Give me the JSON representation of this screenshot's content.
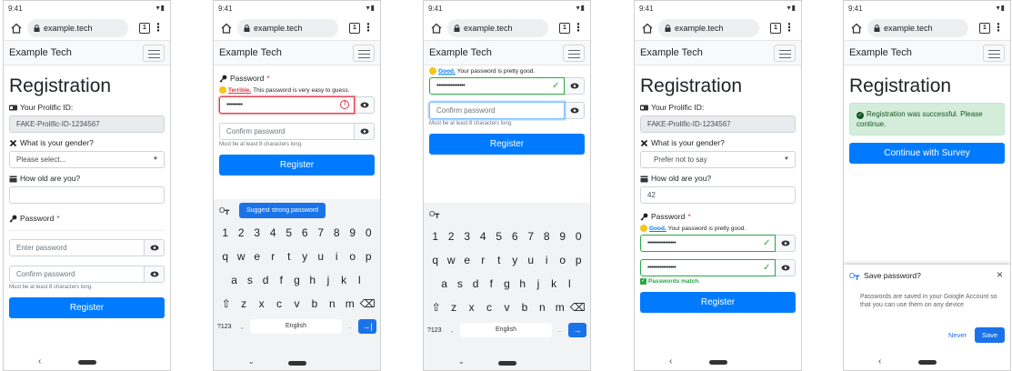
{
  "common": {
    "time": "9:41",
    "url": "example.tech",
    "tab_count": "1",
    "brand": "Example Tech",
    "kebab": "⋮"
  },
  "colors": {
    "primary": "#007bff",
    "success": "#28a745",
    "danger": "#dc3545",
    "chrome_blue": "#1a73e8"
  },
  "form": {
    "title": "Registration",
    "prolific_label": "Your Prolific ID:",
    "prolific_value": "FAKE-Prolific-ID-1234567",
    "gender_label": "What is your gender?",
    "gender_placeholder": "Please select...",
    "gender_selected": "Prefer not to say",
    "age_label": "How old are you?",
    "age_value": "42",
    "password_label": "Password",
    "password_required": "*",
    "password_placeholder": "Enter password",
    "confirm_placeholder": "Confirm password",
    "length_help": "Must be at least 8 characters long.",
    "register_label": "Register",
    "pw_short": "•••••••••",
    "pw_long": "••••••••••••••••",
    "strength_terrible_word": "Terrible.",
    "strength_terrible_text": " This password is very easy to guess.",
    "strength_good_word": "Good.",
    "strength_good_text": " Your password is pretty good.",
    "match_text": "Passwords match.",
    "success_text": "Registration was successful. Please continue.",
    "continue_label": "Continue with Survey"
  },
  "keyboard": {
    "suggest_label": "Suggest strong password",
    "row_numbers": [
      "1",
      "2",
      "3",
      "4",
      "5",
      "6",
      "7",
      "8",
      "9",
      "0"
    ],
    "row_top": [
      "q",
      "w",
      "e",
      "r",
      "t",
      "y",
      "u",
      "i",
      "o",
      "p"
    ],
    "row_mid": [
      "a",
      "s",
      "d",
      "f",
      "g",
      "h",
      "j",
      "k",
      "l"
    ],
    "row_bottom": [
      "z",
      "x",
      "c",
      "v",
      "b",
      "n",
      "m"
    ],
    "symbols_label": "?123",
    "comma": ",",
    "period": ".",
    "space_label": "English"
  },
  "save_sheet": {
    "title": "Save password?",
    "body": "Passwords are saved in your Google Account so that you can use them on any device",
    "never_label": "Never",
    "save_label": "Save"
  },
  "icons": {
    "home": "home-icon",
    "lock": "lock-icon",
    "menu": "hamburger-icon",
    "eye": "eye-icon",
    "id_card": "id-card-icon",
    "gender": "close-icon",
    "calendar": "calendar-icon",
    "key": "key-icon",
    "check": "check-icon",
    "backspace": "backspace-icon",
    "shift": "shift-icon"
  }
}
